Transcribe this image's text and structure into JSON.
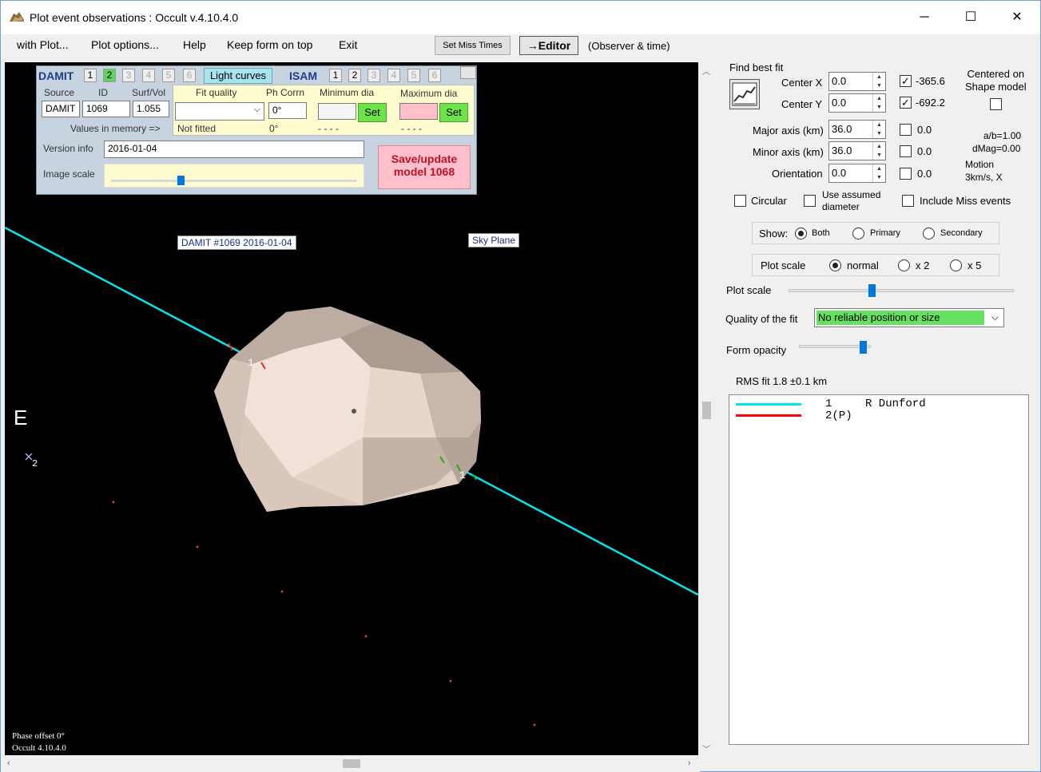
{
  "window": {
    "title": "Plot event observations : Occult v.4.10.4.0",
    "minimize": "─",
    "maximize": "☐",
    "close": "✕"
  },
  "menu": {
    "with_plot": "with Plot...",
    "plot_options": "Plot options...",
    "help": "Help",
    "keep_on_top": "Keep form on top",
    "exit": "Exit",
    "set_miss_times": "Set Miss Times",
    "editor": "→Editor",
    "observer_time": "(Observer & time)"
  },
  "shape_panel": {
    "damit_label": "DAMIT",
    "damit_numbers": [
      "1",
      "2",
      "3",
      "4",
      "5",
      "6"
    ],
    "light_curves": "Light curves",
    "isam_label": "ISAM",
    "isam_numbers": [
      "1",
      "2",
      "3",
      "4",
      "5",
      "6"
    ],
    "source_label": "Source",
    "id_label": "ID",
    "surfvol_label": "Surf/Vol",
    "source_value": "DAMIT",
    "id_value": "1069",
    "surfvol_value": "1.055",
    "values_in_memory": "Values in memory =>",
    "fit_quality_label": "Fit quality",
    "fit_quality_value": "",
    "not_fitted": "Not fitted",
    "ph_corrn_label": "Ph Corrn",
    "ph_corrn_value": "0°",
    "ph_corrn_memory": "0°",
    "min_dia_label": "Minimum dia",
    "max_dia_label": "Maximum dia",
    "set_label": "Set",
    "min_dia_memory": "- - - -",
    "max_dia_memory": "- - - -",
    "version_label": "Version info",
    "version_value": "2016-01-04",
    "image_scale_label": "Image scale",
    "image_scale_value": 0.25,
    "save_button": "Save/update\nmodel  1068"
  },
  "plot": {
    "model_label": "DAMIT #1069 2016-01-04",
    "sky_plane": "Sky Plane",
    "east_label": "E",
    "chord1_label": "1",
    "chord1_label_b": "1",
    "star2_label": "2",
    "phase_offset": "Phase offset 0°",
    "version_footer": "Occult 4.10.4.0"
  },
  "right": {
    "find_best_fit": "Find best fit",
    "center_x_label": "Center X",
    "center_x_value": "0.0",
    "center_x_fixed": "-365.6",
    "center_y_label": "Center Y",
    "center_y_value": "0.0",
    "center_y_fixed": "-692.2",
    "centered_on": "Centered on\nShape model",
    "major_label": "Major axis (km)",
    "major_value": "36.0",
    "major_fixed": "0.0",
    "minor_label": "Minor axis (km)",
    "minor_value": "36.0",
    "minor_fixed": "0.0",
    "orient_label": "Orientation",
    "orient_value": "0.0",
    "orient_fixed": "0.0",
    "ab_ratio": "a/b=1.00",
    "dmag": "dMag=0.00",
    "motion": "Motion\n3km/s, X",
    "circular": "Circular",
    "use_assumed": "Use assumed\ndiameter",
    "include_miss": "Include Miss events",
    "show_label": "Show:",
    "show_both": "Both",
    "show_primary": "Primary",
    "show_secondary": "Secondary",
    "plot_scale_label": "Plot scale",
    "scale_normal": "normal",
    "scale_x2": "x 2",
    "scale_x5": "x 5",
    "plot_scale_slider_label": "Plot scale",
    "plot_scale_slider_value": 0.5,
    "quality_label": "Quality of the fit",
    "quality_value": "No reliable position or size",
    "form_opacity_label": "Form opacity",
    "form_opacity_value": 0.75,
    "rms_fit": "RMS fit  1.8 ±0.1 km",
    "legend": [
      {
        "num": "1",
        "name": "R Dunford",
        "color": "#00e5ee"
      },
      {
        "num": "2(P)",
        "name": "",
        "color": "#ff0000"
      }
    ]
  },
  "colors": {
    "chord": "#00e5ee",
    "shape": "#e8d8cc",
    "quality_green": "#66e060",
    "save_pink": "#ffc0cb"
  }
}
